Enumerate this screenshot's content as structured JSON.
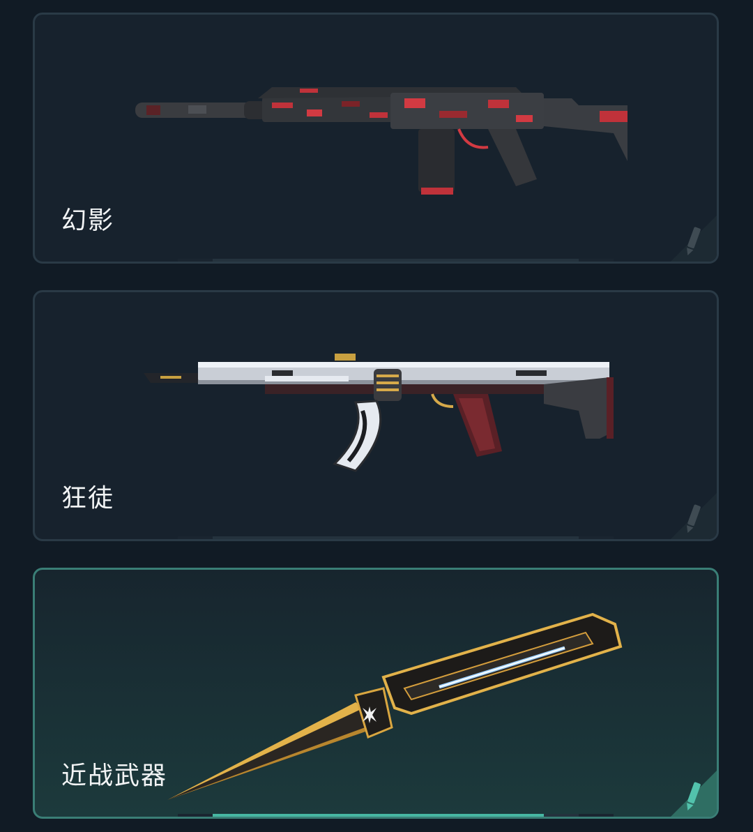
{
  "accent_color": "#46b7a2",
  "cards": [
    {
      "label": "幻影",
      "selected": false,
      "icon": "edit-pencil-icon",
      "progress": 0
    },
    {
      "label": "狂徒",
      "selected": false,
      "icon": "edit-pencil-icon",
      "progress": 0
    },
    {
      "label": "近战武器",
      "selected": true,
      "icon": "edit-pencil-icon",
      "progress": 1
    }
  ]
}
